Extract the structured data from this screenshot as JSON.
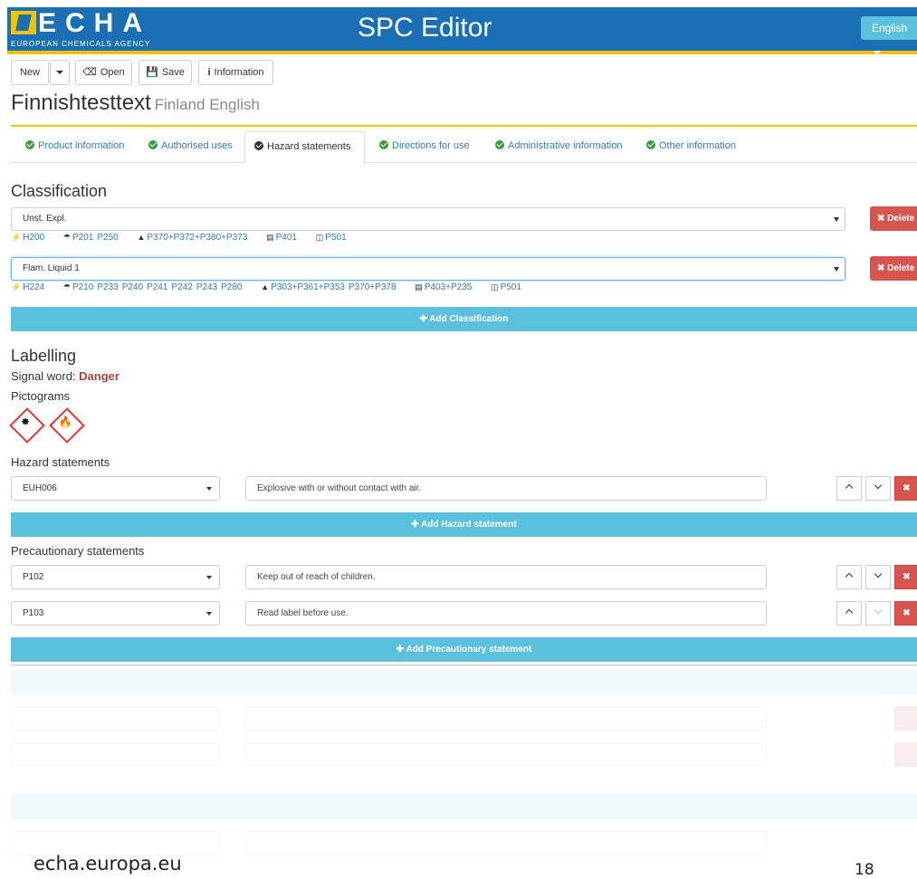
{
  "header": {
    "logo_text": "ECHA",
    "logo_subtitle": "EUROPEAN CHEMICALS AGENCY",
    "app_title": "SPC Editor",
    "language": "English"
  },
  "toolbar": {
    "new_label": "New",
    "open_label": "Open",
    "save_label": "Save",
    "info_label": "Information"
  },
  "document": {
    "title": "Finnishtesttext",
    "subtitle": "Finland English"
  },
  "tabs": [
    {
      "label": "Product information"
    },
    {
      "label": "Authorised uses"
    },
    {
      "label": "Hazard statements",
      "active": true
    },
    {
      "label": "Directions for use"
    },
    {
      "label": "Administrative information"
    },
    {
      "label": "Other information"
    }
  ],
  "classification": {
    "heading": "Classification",
    "delete_label": "Delete",
    "add_label": "Add Classification",
    "rows": [
      {
        "value": "Unst. Expl.",
        "hazard": "H200",
        "prevention": [
          "P201",
          "P250"
        ],
        "response": [
          "P370+P372+P380+P373"
        ],
        "storage": [
          "P401"
        ],
        "disposal": [
          "P501"
        ]
      },
      {
        "value": "Flam. Liquid 1",
        "hazard": "H224",
        "prevention": [
          "P210",
          "P233",
          "P240",
          "P241",
          "P242",
          "P243",
          "P280"
        ],
        "response": [
          "P303+P361+P353",
          "P370+P378"
        ],
        "storage": [
          "P403+P235"
        ],
        "disposal": [
          "P501"
        ]
      }
    ]
  },
  "labelling": {
    "heading": "Labelling",
    "signal_word_label": "Signal word:",
    "signal_word": "Danger",
    "pictograms_label": "Pictograms",
    "pictograms": [
      "explosive-pictogram-icon",
      "flame-pictogram-icon"
    ]
  },
  "hazard_statements": {
    "heading": "Hazard statements",
    "add_label": "Add Hazard statement",
    "rows": [
      {
        "code": "EUH006",
        "text": "Explosive with or without contact with air."
      }
    ]
  },
  "precautionary_statements": {
    "heading": "Precautionary statements",
    "add_label": "Add Precautionary statement",
    "rows": [
      {
        "code": "P102",
        "text": "Keep out of reach of children."
      },
      {
        "code": "P103",
        "text": "Read label before use."
      }
    ]
  },
  "footer": {
    "site": "echa.europa.eu",
    "page_number": "18"
  },
  "colors": {
    "header_blue": "#1b6fb5",
    "accent_yellow": "#f3c300",
    "info_blue": "#5bc0de",
    "danger_red": "#d9534f",
    "success_green": "#3c9b3c"
  }
}
